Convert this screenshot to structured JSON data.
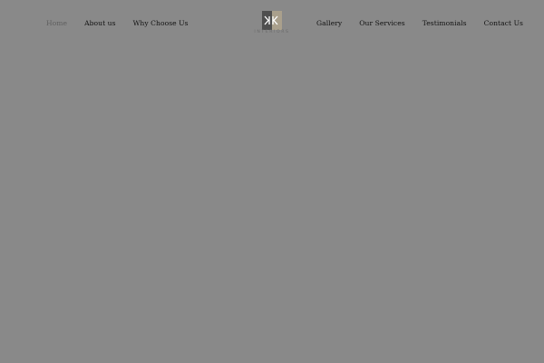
{
  "nav": {
    "left": [
      {
        "label": "Home",
        "active": true
      },
      {
        "label": "About us"
      },
      {
        "label": "Why Choose Us"
      }
    ],
    "right": [
      {
        "label": "Gallery"
      },
      {
        "label": "Our Services"
      },
      {
        "label": "Testimonials"
      },
      {
        "label": "Contact Us"
      }
    ]
  },
  "logo": {
    "mark": "KK",
    "word": "INTERIORS"
  },
  "colors": {
    "background": "#898989",
    "nav_text": "#111111",
    "nav_active": "#5e5e5e",
    "logo_dark": "#4f4f4f",
    "logo_beige": "#aaa08c"
  }
}
